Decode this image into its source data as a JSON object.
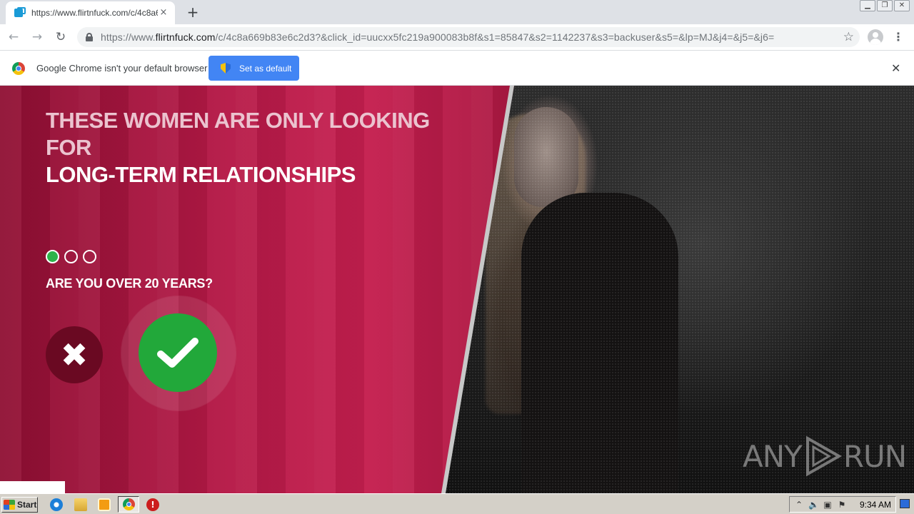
{
  "browser": {
    "tab_title": "https://www.flirtnfuck.com/c/4c8a669",
    "tab_close": "×",
    "new_tab": "+",
    "url_scheme": "https://www.",
    "url_host": "flirtnfuck.com",
    "url_path": "/c/4c8a669b83e6c2d3?&click_id=uucxx5fc219a900083b8f&s1=85847&s2=1142237&s3=backuser&s5=&lp=MJ&j4=&j5=&j6=",
    "back": "←",
    "forward": "→",
    "reload": "↻",
    "star": "☆",
    "menu": "⋮"
  },
  "infobar": {
    "message": "Google Chrome isn't your default browser",
    "button": "Set as default",
    "close": "✕"
  },
  "page": {
    "headline_top": "THESE WOMEN ARE ONLY LOOKING FOR",
    "headline_bottom": "LONG-TERM RELATIONSHIPS",
    "steps": {
      "total": 3,
      "current": 1
    },
    "question": "ARE YOU OVER 20 YEARS?",
    "no_symbol": "✖",
    "colors": {
      "accent_green": "#22a83a",
      "background": "#b61947"
    }
  },
  "watermark": {
    "left": "ANY",
    "right": "RUN"
  },
  "taskbar": {
    "start": "Start",
    "stop_symbol": "!",
    "clock": "9:34 AM"
  }
}
